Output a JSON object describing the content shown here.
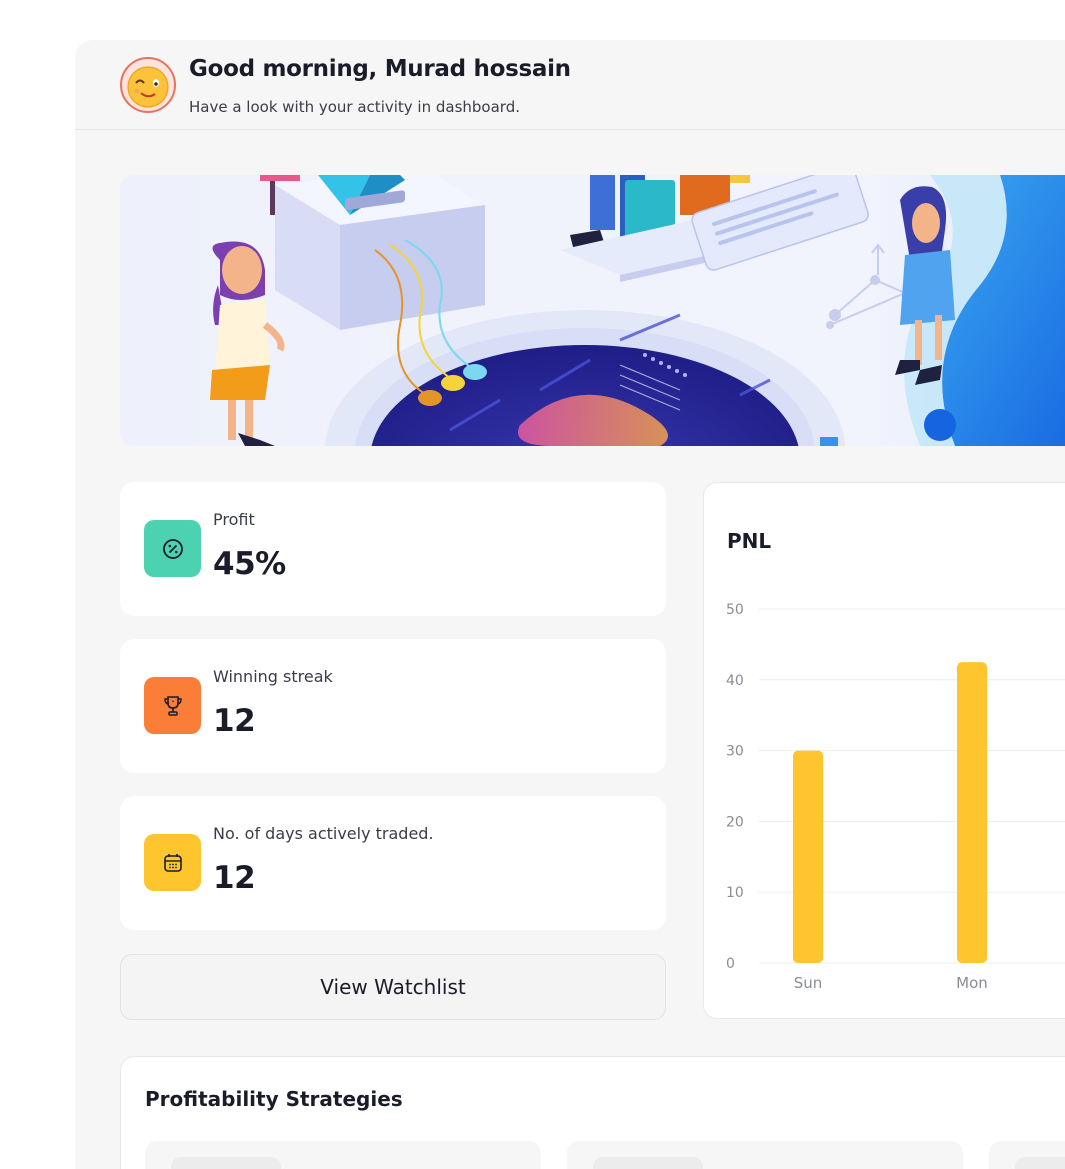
{
  "header": {
    "greeting": "Good morning, Murad hossain",
    "subtitle": "Have a look with your activity in dashboard."
  },
  "stats": [
    {
      "label": "Profit",
      "value": "45%",
      "icon": "percent-badge-icon",
      "color": "#4cd2b0"
    },
    {
      "label": "Winning streak",
      "value": "12",
      "icon": "trophy-icon",
      "color": "#fb7e38"
    },
    {
      "label": "No. of days actively traded.",
      "value": "12",
      "icon": "calendar-icon",
      "color": "#fec52e"
    }
  ],
  "watchlist_button": "View Watchlist",
  "chart_data": {
    "type": "bar",
    "title": "PNL",
    "categories": [
      "Sun",
      "Mon"
    ],
    "values": [
      30,
      42.5
    ],
    "ylim": [
      0,
      50
    ],
    "yticks": [
      0,
      10,
      20,
      30,
      40,
      50
    ],
    "grid": true,
    "bar_color": "#fec52e"
  },
  "strategies": {
    "title": "Profitability Strategies"
  }
}
